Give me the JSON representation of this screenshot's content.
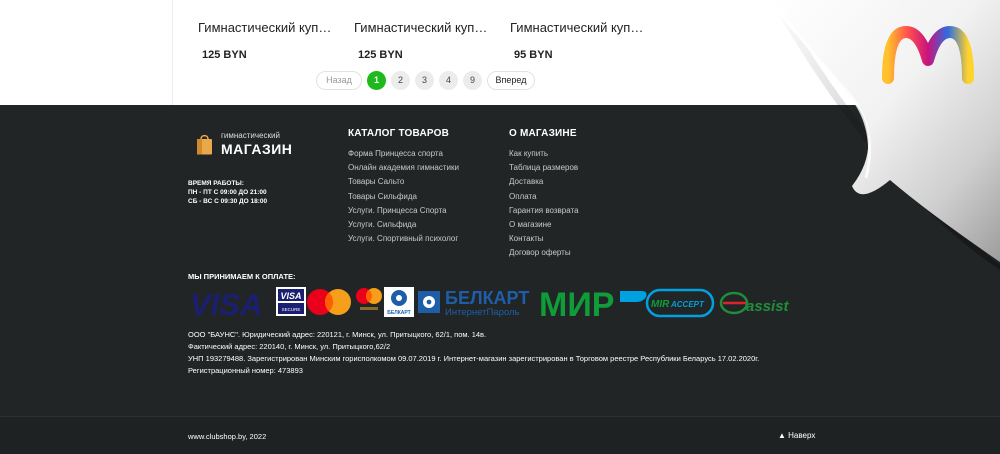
{
  "products": [
    {
      "name": "Гимнастический купальник",
      "price": "125 BYN"
    },
    {
      "name": "Гимнастический купальник",
      "price": "125 BYN"
    },
    {
      "name": "Гимнастический купальник",
      "price": "95 BYN"
    }
  ],
  "pagination": {
    "prev": "Назад",
    "pages": [
      "1",
      "2",
      "3",
      "4",
      "9"
    ],
    "active": "1",
    "next": "Вперед"
  },
  "logo": {
    "line1": "гимнастический",
    "line2": "МАГАЗИН"
  },
  "hours": {
    "title": "ВРЕМЯ РАБОТЫ:",
    "weekdays": "ПН - ПТ С 09:00 ДО 21:00",
    "weekend": "СБ - ВС С 09:30 ДО 18:00"
  },
  "catalog": {
    "title": "КАТАЛОГ ТОВАРОВ",
    "items": [
      "Форма Принцесса спорта",
      "Онлайн академия гимнастики",
      "Товары Сальто",
      "Товары Сильфида",
      "Услуги. Принцесса Спорта",
      "Услуги. Сильфида",
      "Услуги. Спортивный психолог"
    ]
  },
  "about": {
    "title": "О МАГАЗИНЕ",
    "items": [
      "Как купить",
      "Таблица размеров",
      "Доставка",
      "Оплата",
      "Гарантия возврата",
      "О магазине",
      "Контакты",
      "Договор оферты"
    ]
  },
  "payment": {
    "title": "МЫ ПРИНИМАЕМ К ОПЛАТЕ:",
    "logos": {
      "visa": "VISA",
      "visa_secure_top": "VISA",
      "visa_secure_bottom": "SECURE",
      "belkart_small": "БЕЛКАРТ",
      "belkart_big": "БЕЛКАРТ",
      "internet_parol": "ИнтернетПароль",
      "mir": "МИР",
      "mir_accept_1": "MIR",
      "mir_accept_2": "ACCEPT",
      "assist": "assist"
    }
  },
  "legal": {
    "line1": "ООО \"БАУНС\". Юридический адрес: 220121, г. Минск, ул. Притыцкого, 62/1, пом. 14в.",
    "line2": "Фактический адрес: 220140, г. Минск, ул. Притыцкого,62/2",
    "line3": "УНП 193279488. Зарегистрирован Минским горисполкомом 09.07.2019 г. Интернет-магазин зарегистрирован в Торговом реестре Республики Беларусь 17.02.2020г.",
    "line4": "Регистрационный номер: 473893"
  },
  "bottom": {
    "copyright": "www.clubshop.by, 2022",
    "to_top": "▲ Наверх"
  },
  "colors": {
    "accent_green": "#1db91d",
    "footer_bg": "#222526",
    "visa_blue": "#1a1f71",
    "mir_green": "#0f9d3a",
    "belkart_blue": "#1e5ea8"
  }
}
